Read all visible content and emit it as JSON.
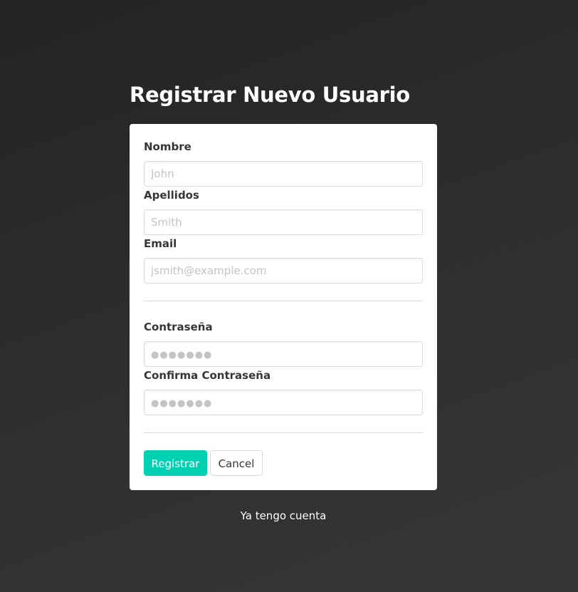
{
  "title": "Registrar Nuevo Usuario",
  "form": {
    "name": {
      "label": "Nombre",
      "placeholder": "John",
      "value": ""
    },
    "surname": {
      "label": "Apellidos",
      "placeholder": "Smith",
      "value": ""
    },
    "email": {
      "label": "Email",
      "placeholder": "jsmith@example.com",
      "value": ""
    },
    "password": {
      "label": "Contraseña",
      "placeholder": "●●●●●●●",
      "value": ""
    },
    "password_confirm": {
      "label": "Confirma Contraseña",
      "placeholder": "●●●●●●●",
      "value": ""
    }
  },
  "actions": {
    "submit_label": "Registrar",
    "cancel_label": "Cancel"
  },
  "footer": {
    "login_link": "Ya tengo cuenta"
  },
  "colors": {
    "primary": "#00d1b2",
    "background": "#2e2e2e",
    "card": "#ffffff",
    "label_text": "#363636",
    "placeholder_text": "#c4c4c4",
    "border": "#dbdbdb"
  }
}
